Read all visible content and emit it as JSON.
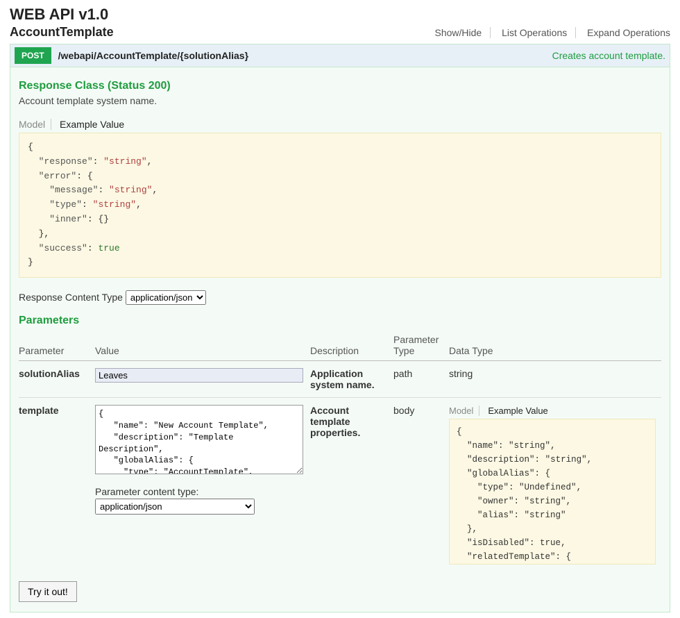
{
  "title": "WEB API v1.0",
  "section": "AccountTemplate",
  "actions": {
    "showHide": "Show/Hide",
    "listOps": "List Operations",
    "expandOps": "Expand Operations"
  },
  "operation": {
    "method": "POST",
    "path": "/webapi/AccountTemplate/{solutionAlias}",
    "summary": "Creates account template."
  },
  "response": {
    "heading": "Response Class (Status 200)",
    "description": "Account template system name.",
    "tabs": {
      "model": "Model",
      "example": "Example Value"
    }
  },
  "responseExample": {
    "keys": {
      "response": "\"response\"",
      "error": "\"error\"",
      "message": "\"message\"",
      "type": "\"type\"",
      "inner": "\"inner\"",
      "success": "\"success\""
    },
    "vals": {
      "string": "\"string\"",
      "true": "true"
    }
  },
  "contentType": {
    "label": "Response Content Type",
    "options": [
      "application/json"
    ],
    "selected": "application/json"
  },
  "parameters": {
    "heading": "Parameters",
    "columns": {
      "parameter": "Parameter",
      "value": "Value",
      "description": "Description",
      "paramType": "Parameter Type",
      "dataType": "Data Type"
    },
    "rows": [
      {
        "name": "solutionAlias",
        "value": "Leaves",
        "description": "Application system name.",
        "paramType": "path",
        "dataType": "string"
      },
      {
        "name": "template",
        "body": "{\n   \"name\": \"New Account Template\",\n   \"description\": \"Template Description\",\n   \"globalAlias\": {\n     \"type\": \"AccountTemplate\",\n     \"owner\": \"Leaves\",",
        "description": "Account template properties.",
        "paramType": "body",
        "contentTypeLabel": "Parameter content type:",
        "contentType": "application/json"
      }
    ],
    "dataTypeTabs": {
      "model": "Model",
      "example": "Example Value"
    }
  },
  "dtExample": {
    "keys": {
      "name": "\"name\"",
      "description": "\"description\"",
      "globalAlias": "\"globalAlias\"",
      "type": "\"type\"",
      "owner": "\"owner\"",
      "alias": "\"alias\"",
      "isDisabled": "\"isDisabled\"",
      "relatedTemplate": "\"relatedTemplate\""
    },
    "vals": {
      "string": "\"string\"",
      "undefined": "\"Undefined\"",
      "true": "true"
    }
  },
  "tryButton": "Try it out!"
}
